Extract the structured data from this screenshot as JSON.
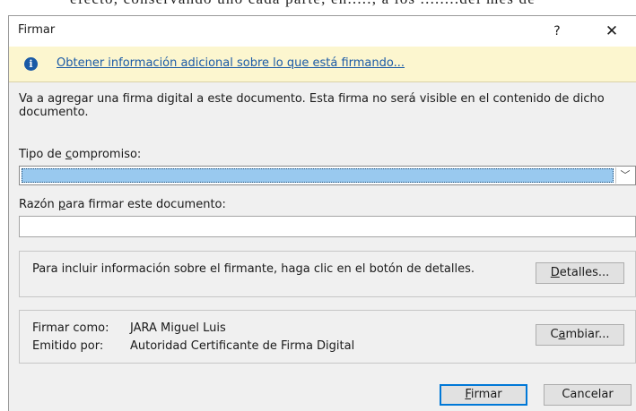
{
  "background_document": {
    "text": "efecto, conservando uno cada parte, en....., a los ........del mes de"
  },
  "dialog": {
    "title": "Firmar",
    "help_label": "?",
    "close_label": "✕",
    "info_icon": "info-icon",
    "info_link": "Obtener información adicional sobre lo que está firmando...",
    "description": "Va a agregar una firma digital a este documento. Esta firma no será visible en el contenido de dicho documento.",
    "commitment": {
      "label_pre": "Tipo de ",
      "label_key": "c",
      "label_post": "ompromiso:",
      "selected_value": "",
      "arrow": "﹀"
    },
    "reason": {
      "label_pre": "Razón ",
      "label_key": "p",
      "label_post": "ara firmar este documento:",
      "value": ""
    },
    "details": {
      "text": "Para incluir información sobre el firmante, haga clic en el botón de detalles.",
      "button_key": "D",
      "button_rest": "etalles..."
    },
    "signer": {
      "sign_as_label": "Firmar como:",
      "sign_as_value": "JARA Miguel Luis",
      "issued_by_label": "Emitido por:",
      "issued_by_value": "Autoridad Certificante de Firma Digital",
      "change_pre": "C",
      "change_key": "a",
      "change_post": "mbiar..."
    },
    "buttons": {
      "sign_key": "F",
      "sign_rest": "irmar",
      "cancel": "Cancelar"
    }
  },
  "colors": {
    "link": "#1a5aa6",
    "infobar": "#fcf6cf",
    "selection": "#99c9ef",
    "primary_border": "#0078d7"
  }
}
